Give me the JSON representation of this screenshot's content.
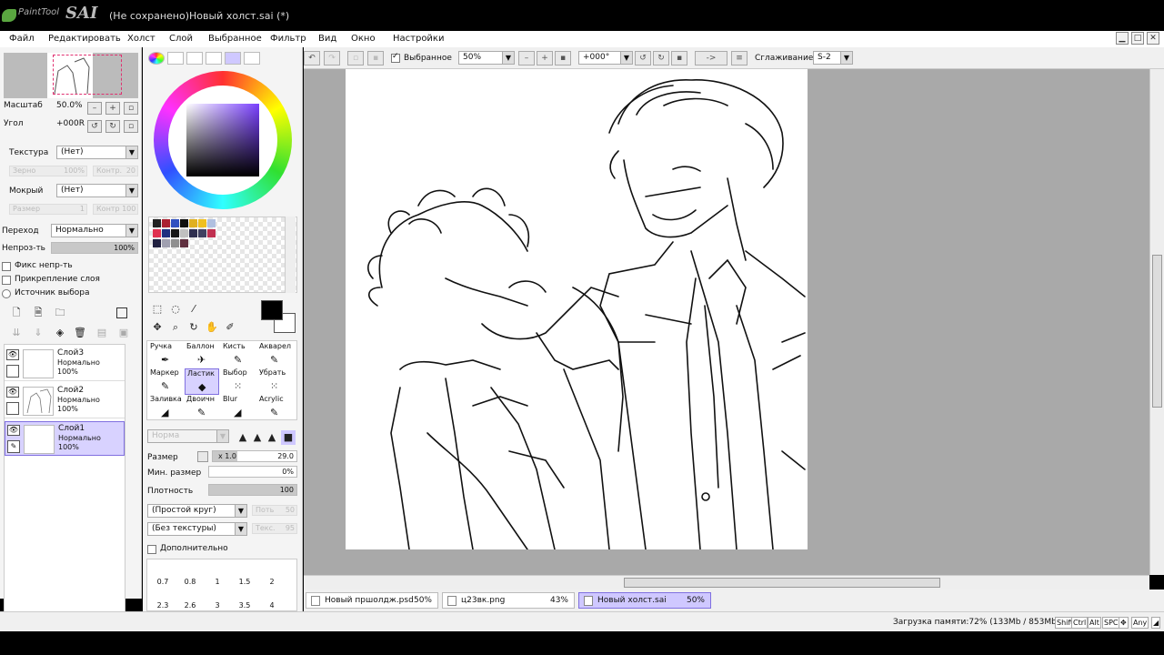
{
  "window": {
    "brand": "PaintTool",
    "brand_sai": "SAI",
    "title": "(Не сохранено)Новый холст.sai (*)"
  },
  "menu": [
    "Файл",
    "Редактировать",
    "Холст",
    "Слой",
    "Выбранное",
    "Фильтр",
    "Вид",
    "Окно",
    "Настройки"
  ],
  "navigator": {
    "zoom_label": "Масштаб",
    "zoom_value": "50.0%",
    "angle_label": "Угол",
    "angle_value": "+000R"
  },
  "texture": {
    "texture_label": "Текстура",
    "texture_value": "(Нет)",
    "grain_label": "Зерно",
    "grain_value": "100%",
    "contrast_label": "Контр.",
    "contrast_value": "20",
    "wet_label": "Мокрый",
    "wet_value": "(Нет)",
    "size_label": "Размер",
    "size_value": "1",
    "contrast2_value": "Контр 100"
  },
  "layer_props": {
    "blend_label": "Переход",
    "blend_value": "Нормально",
    "opacity_label": "Непроз-ть",
    "opacity_value": "100%",
    "opacity_fraction": 1.0,
    "checks": [
      "Фикс непр-ть",
      "Прикрепление слоя",
      "Источник выбора"
    ]
  },
  "layers": [
    {
      "name": "Слой3",
      "mode": "Нормально",
      "opacity": "100%",
      "selected": false
    },
    {
      "name": "Слой2",
      "mode": "Нормально",
      "opacity": "100%",
      "selected": false
    },
    {
      "name": "Слой1",
      "mode": "Нормально",
      "opacity": "100%",
      "selected": true
    }
  ],
  "swatches": [
    "#222222",
    "#aa2030",
    "#3050c0",
    "#101010",
    "#e0b020",
    "#f0c020",
    "#b0c0e0",
    "#e03050",
    "#203080",
    "#181818",
    "#c0c0c0",
    "#303050",
    "#404060",
    "#c03050",
    "#202040",
    "#a0a0b0",
    "#909090",
    "#603040"
  ],
  "brushes": [
    {
      "name": "Ручка",
      "glyph": "✒",
      "active": false
    },
    {
      "name": "Баллон",
      "glyph": "✈",
      "active": false
    },
    {
      "name": "Кисть",
      "glyph": "✎",
      "active": false
    },
    {
      "name": "Акварел",
      "glyph": "✎",
      "active": false
    },
    {
      "name": "Маркер",
      "glyph": "✎",
      "active": false
    },
    {
      "name": "Ластик",
      "glyph": "◆",
      "active": true
    },
    {
      "name": "Выбор",
      "glyph": "⁙",
      "active": false
    },
    {
      "name": "Убрать",
      "glyph": "⁙",
      "active": false
    },
    {
      "name": "Заливка",
      "glyph": "◢",
      "active": false
    },
    {
      "name": "Двоичн",
      "glyph": "✎",
      "active": false
    },
    {
      "name": "Blur",
      "glyph": "◢",
      "active": false
    },
    {
      "name": "Acrylic",
      "glyph": "✎",
      "active": false
    }
  ],
  "brush_params": {
    "mode_value": "Норма",
    "size_label": "Размер",
    "size_mult": "x 1.0",
    "size_value": "29.0",
    "size_fraction": 0.29,
    "min_size_label": "Мин. размер",
    "min_size_value": "0%",
    "min_size_fraction": 0.0,
    "density_label": "Плотность",
    "density_value": "100",
    "density_fraction": 1.0,
    "shape_value": "(Простой круг)",
    "shape_fader": "Поть",
    "shape_fader_value": "50",
    "texture_value": "(Без текстуры)",
    "texture_fader": "Текс.",
    "texture_fader_value": "95",
    "extra_label": "Дополнительно"
  },
  "sizes": [
    "0.7",
    "0.8",
    "1",
    "1.5",
    "2",
    "2.3",
    "2.6",
    "3",
    "3.5",
    "4"
  ],
  "toolbar": {
    "selection_label": "Выбранное",
    "zoom_value": "50%",
    "rotate_value": "+000°",
    "flip_label": "->",
    "smoothing_label": "Сглаживание",
    "smoothing_value": "S-2"
  },
  "documents": [
    {
      "name": "Новый пршолдж.psd",
      "zoom": "50%",
      "active": false
    },
    {
      "name": "ц23вк.png",
      "zoom": "43%",
      "active": false
    },
    {
      "name": "Новый холст.sai",
      "zoom": "50%",
      "active": true
    }
  ],
  "status": {
    "memory": "Загрузка памяти:72% (133Mb / 853Mb)",
    "keys": [
      "Shift",
      "Ctrl",
      "Alt",
      "SPC",
      "✥",
      "Any"
    ]
  }
}
